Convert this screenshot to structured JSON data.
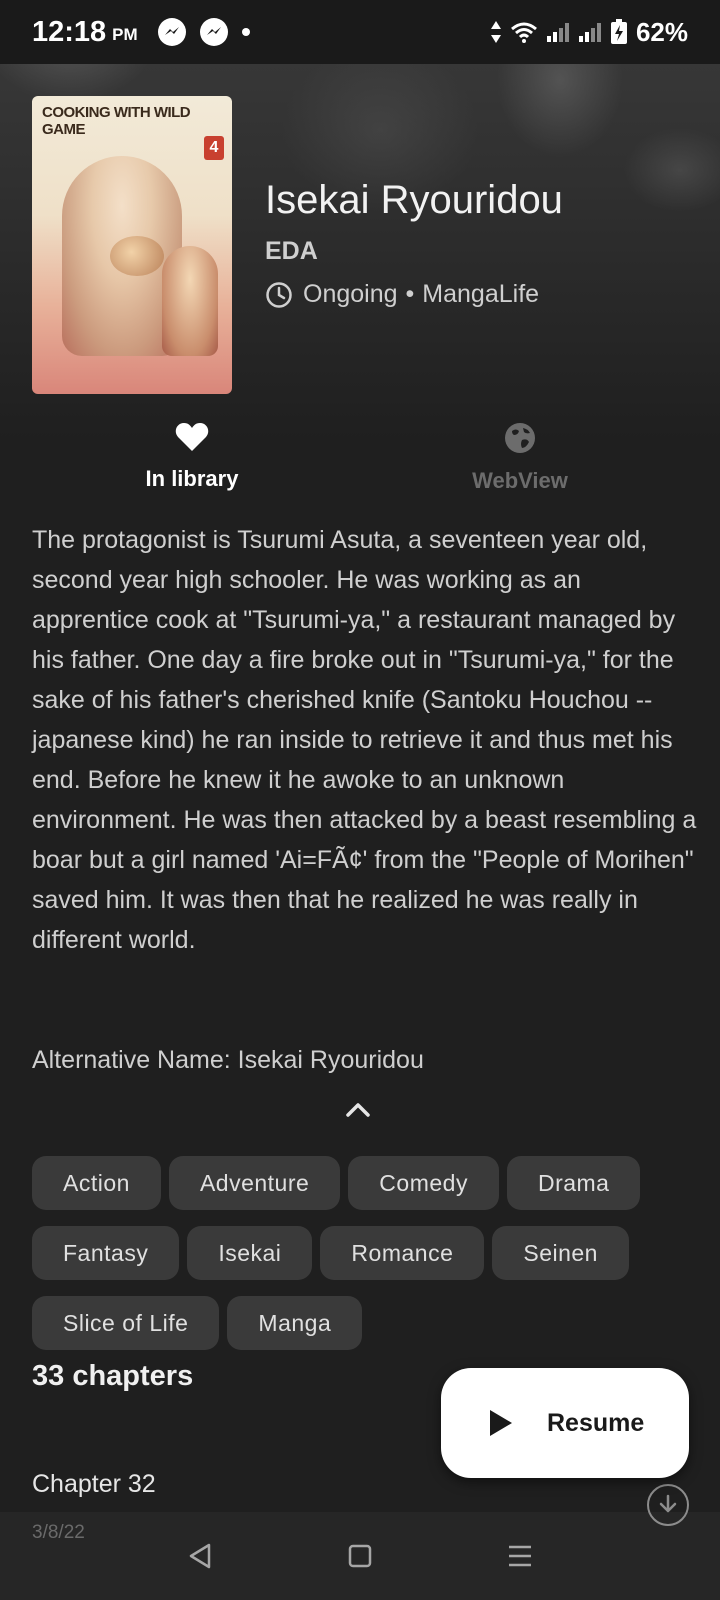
{
  "status_bar": {
    "time": "12:18",
    "ampm": "PM",
    "battery": "62%",
    "icons": [
      "messenger-icon",
      "messenger-icon",
      "dot-icon",
      "data-arrows-icon",
      "wifi-icon",
      "signal-icon",
      "signal-icon",
      "battery-charging-icon"
    ]
  },
  "manga": {
    "cover_title": "COOKING WITH WILD GAME",
    "cover_volume": "4",
    "title": "Isekai Ryouridou",
    "author": "EDA",
    "status": "Ongoing",
    "separator": "•",
    "source": "MangaLife"
  },
  "actions": {
    "library_label": "In library",
    "webview_label": "WebView"
  },
  "description": "The protagonist is Tsurumi Asuta, a seventeen year old, second year high schooler. He was working as an apprentice cook at \"Tsurumi-ya,\" a restaurant managed by his father. One day a fire broke out in \"Tsurumi-ya,\" for the sake of his father's cherished knife (Santoku Houchou -- japanese kind) he ran inside to retrieve it and thus met his end. Before he knew it he awoke to an unknown environment. He was then attacked by a beast resembling a boar but a girl named 'Ai=FÃ¢' from the \"People of Morihen\" saved him. It was then that he realized he was really in different world.",
  "alternative_name": "Alternative Name: Isekai Ryouridou",
  "tags": [
    "Action",
    "Adventure",
    "Comedy",
    "Drama",
    "Fantasy",
    "Isekai",
    "Romance",
    "Seinen",
    "Slice of Life",
    "Manga"
  ],
  "chapters": {
    "count_label": "33 chapters",
    "items": [
      {
        "title": "Chapter 32",
        "date": "3/8/22"
      }
    ]
  },
  "resume_label": "Resume",
  "colors": {
    "background": "#1f1f1f",
    "tag_bg": "#3a3a3a",
    "accent": "#ffffff",
    "muted": "#6c6c6c"
  }
}
